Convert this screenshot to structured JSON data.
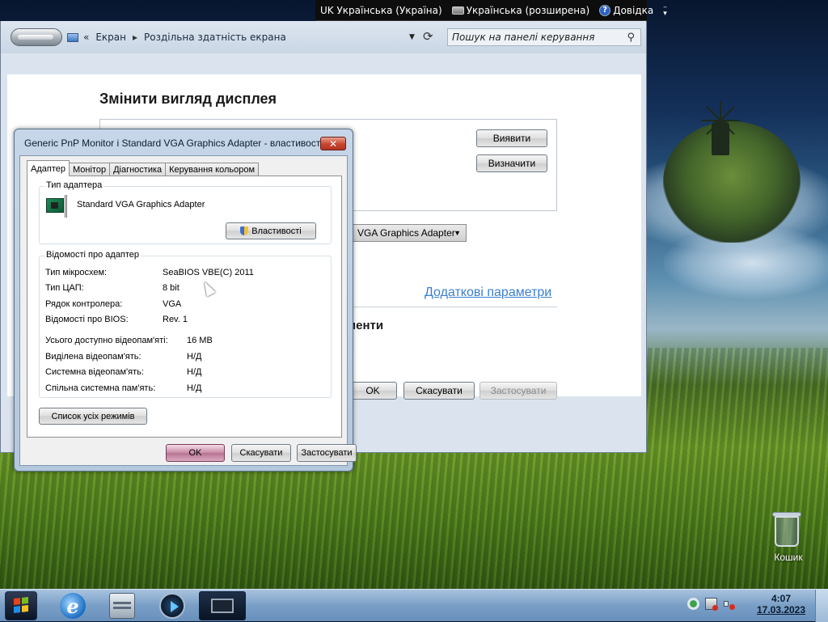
{
  "langbar": {
    "input_language": "UK Українська (Україна)",
    "keyboard_layout": "Українська (розширена)",
    "help": "Довідка"
  },
  "control_panel": {
    "breadcrumb_prefix": "«",
    "breadcrumb": [
      "Екран",
      "Роздільна здатність екрана"
    ],
    "search_placeholder": "Пошук на панелі керування",
    "heading": "Змінити вигляд дисплея",
    "detect_button": "Виявити",
    "identify_button": "Визначити",
    "adapter_select": "VGA Graphics Adapter",
    "advanced_link": "Додаткові параметри",
    "section_fragment": "менти",
    "ok_button": "OK",
    "cancel_button": "Скасувати",
    "apply_button": "Застосувати"
  },
  "dialog": {
    "title": "Generic PnP Monitor і Standard VGA Graphics Adapter - властивості",
    "tabs": [
      "Адаптер",
      "Монітор",
      "Діагностика",
      "Керування кольором"
    ],
    "active_tab": "Адаптер",
    "adapter_type_group": "Тип адаптера",
    "adapter_name": "Standard VGA Graphics Adapter",
    "properties_button": "Властивості",
    "adapter_info_group": "Відомості про адаптер",
    "info_rows": [
      {
        "label": "Тип мікросхем:",
        "value": "SeaBIOS VBE(C) 2011"
      },
      {
        "label": "Тип ЦАП:",
        "value": "8 bit"
      },
      {
        "label": "Рядок контролера:",
        "value": "VGA"
      },
      {
        "label": "Відомості про BIOS:",
        "value": "Rev. 1"
      }
    ],
    "memory_rows": [
      {
        "label": "Усього доступно відеопам'яті:",
        "value": "16 MB"
      },
      {
        "label": "Виділена відеопам'ять:",
        "value": "Н/Д"
      },
      {
        "label": "Системна відеопам'ять:",
        "value": "Н/Д"
      },
      {
        "label": "Спільна системна пам'ять:",
        "value": "Н/Д"
      }
    ],
    "list_modes_button": "Список усіх режимів",
    "ok_button": "OK",
    "cancel_button": "Скасувати",
    "apply_button": "Застосувати"
  },
  "desktop": {
    "recycle_bin_label": "Кошик"
  },
  "taskbar": {
    "time": "4:07",
    "date": "17.03.2023"
  }
}
